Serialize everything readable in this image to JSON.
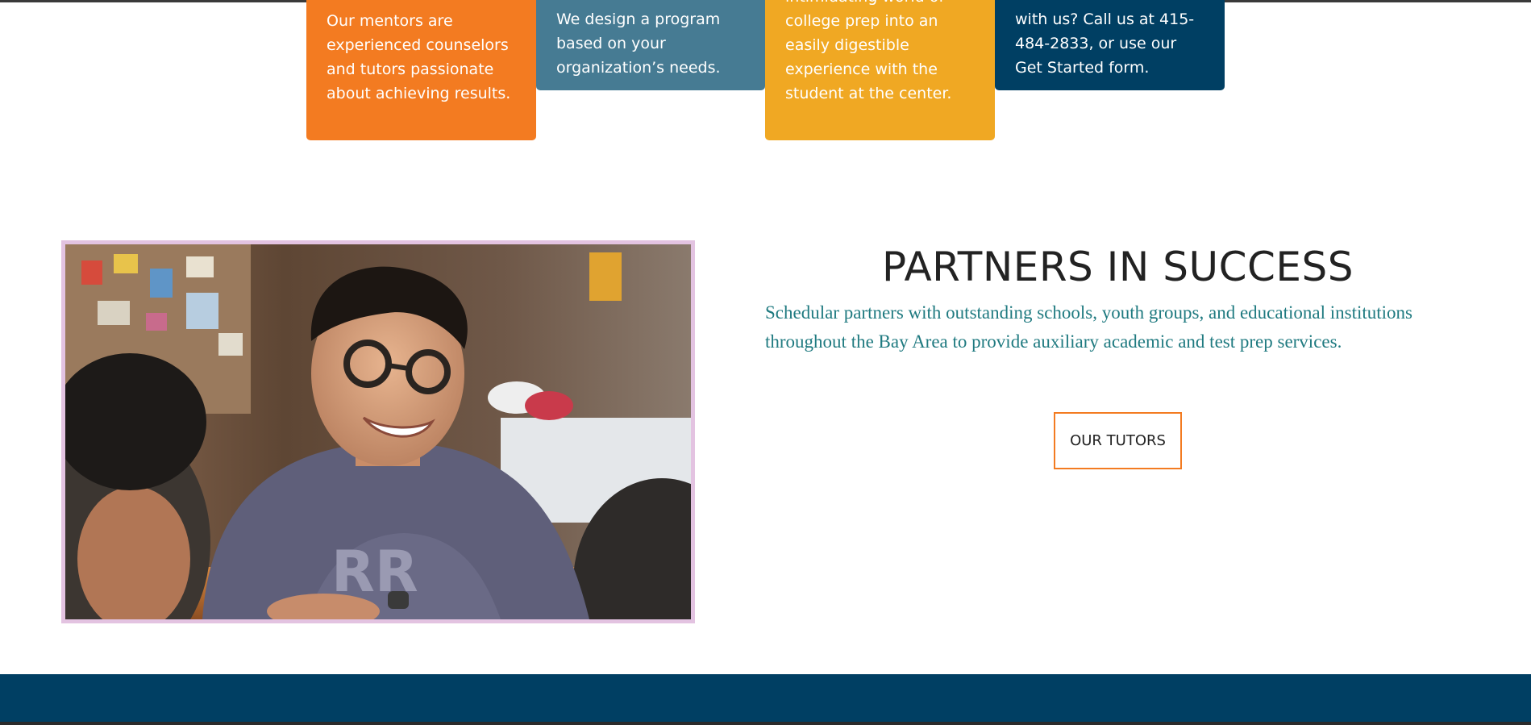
{
  "cards": [
    {
      "text": "Our mentors are experienced counselors and tutors passionate about achieving results.",
      "color": "#f37b21"
    },
    {
      "text": "We design a program based on your organization’s needs.",
      "color": "#467b93"
    },
    {
      "text": "intimidating world of college prep into an easily digestible experience with the student at the center.",
      "color": "#f0a823"
    },
    {
      "text": "with us? Call us at 415-484-2833, or use our Get Started form.",
      "color": "#003f63"
    }
  ],
  "partners": {
    "title": "PARTNERS IN SUCCESS",
    "description": "Schedular partners with outstanding schools, youth groups, and educational institutions throughout the Bay Area to provide auxiliary academic and test prep services.",
    "button_label": "OUR TUTORS"
  },
  "colors": {
    "accent_orange": "#f37b21",
    "navy": "#003f63",
    "teal_text": "#1f7a80",
    "photo_border": "#e3c3e1"
  }
}
